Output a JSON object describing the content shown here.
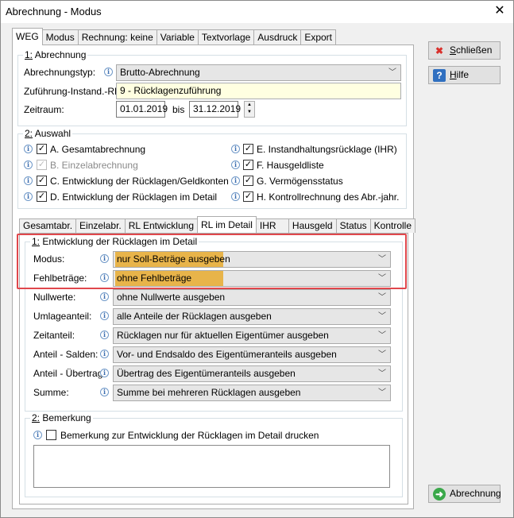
{
  "window": {
    "title": "Abrechnung - Modus",
    "close_glyph": "✕"
  },
  "main_tabs": [
    {
      "label": "WEG"
    },
    {
      "label": "Modus"
    },
    {
      "label": "Rechnung: keine"
    },
    {
      "label": "Variable"
    },
    {
      "label": "Textvorlage"
    },
    {
      "label": "Ausdruck"
    },
    {
      "label": "Export"
    }
  ],
  "abrechnung": {
    "group_num": "1:",
    "group_title": " Abrechnung",
    "typ_label": "Abrechnungstyp:",
    "typ_value": "Brutto-Abrechnung",
    "zufuehrung_label": "Zuführung-Instand.-RL:",
    "zufuehrung_value": "9 - Rücklagenzuführung",
    "zeitraum_label": "Zeitraum:",
    "zeitraum_from": "01.01.2019",
    "bis_label": "bis",
    "zeitraum_to": "31.12.2019"
  },
  "auswahl": {
    "group_num": "2:",
    "group_title": " Auswahl",
    "left": [
      {
        "label": "A.  Gesamtabrechnung",
        "checked": true,
        "disabled": false
      },
      {
        "label": "B.  Einzelabrechnung",
        "checked": true,
        "disabled": true
      },
      {
        "label": "C.  Entwicklung der Rücklagen/Geldkonten",
        "checked": true,
        "disabled": false
      },
      {
        "label": "D.  Entwicklung der Rücklagen im Detail",
        "checked": true,
        "disabled": false
      }
    ],
    "right": [
      {
        "label": "E.  Instandhaltungsrücklage (IHR)",
        "checked": true
      },
      {
        "label": "F.  Hausgeldliste",
        "checked": true
      },
      {
        "label": "G.  Vermögensstatus",
        "checked": true
      },
      {
        "label": "H.  Kontrollrechnung des Abr.-jahr.",
        "checked": true
      }
    ]
  },
  "sub_tabs": [
    {
      "label": "Gesamtabr."
    },
    {
      "label": "Einzelabr."
    },
    {
      "label": "RL Entwicklung"
    },
    {
      "label": "RL im Detail"
    },
    {
      "label": "IHR"
    },
    {
      "label": "Hausgeld"
    },
    {
      "label": "Status"
    },
    {
      "label": "Kontrolle"
    }
  ],
  "detail": {
    "group_num": "1:",
    "group_title": " Entwicklung der Rücklagen im Detail",
    "rows": [
      {
        "label": "Modus:",
        "value": "nur Soll-Beträge ausgeben"
      },
      {
        "label": "Fehlbeträge:",
        "value": "ohne Fehlbeträge"
      },
      {
        "label": "Nullwerte:",
        "value": "ohne Nullwerte ausgeben"
      },
      {
        "label": "Umlageanteil:",
        "value": "alle Anteile der Rücklagen ausgeben"
      },
      {
        "label": "Zeitanteil:",
        "value": "Rücklagen nur für aktuellen Eigentümer ausgeben"
      },
      {
        "label": "Anteil - Salden:",
        "value": "Vor- und Endsaldo des Eigentümeranteils ausgeben"
      },
      {
        "label": "Anteil - Übertrag:",
        "value": "Übertrag des Eigentümeranteils ausgeben"
      },
      {
        "label": "Summe:",
        "value": "Summe bei mehreren Rücklagen ausgeben"
      }
    ]
  },
  "bemerkung": {
    "group_num": "2:",
    "group_title": " Bemerkung",
    "checkbox_label": "Bemerkung zur Entwicklung der Rücklagen im Detail drucken",
    "checked": false,
    "text": ""
  },
  "buttons": {
    "close_label_u": "S",
    "close_label_rest": "chließen",
    "help_label_u": "H",
    "help_label_rest": "ilfe",
    "run_label": "Abrechnung"
  },
  "icons": {
    "close_btn": "x-icon",
    "help_btn": "question-icon",
    "run_btn": "arrow-right-circle-icon",
    "info": "info-icon"
  },
  "colors": {
    "highlight": "#e8b44a",
    "annotation_box": "#e0474c",
    "yellow_field": "#ffffe1"
  }
}
